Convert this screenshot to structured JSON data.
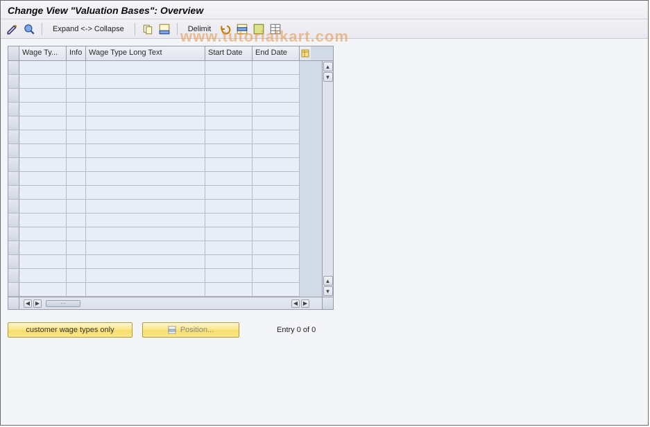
{
  "title": "Change View \"Valuation Bases\": Overview",
  "toolbar": {
    "expand_collapse_label": "Expand <-> Collapse",
    "delimit_label": "Delimit"
  },
  "table": {
    "columns": {
      "wage_type": "Wage Ty...",
      "info": "Info",
      "long_text": "Wage Type Long Text",
      "start_date": "Start Date",
      "end_date": "End Date"
    },
    "rows": [
      {},
      {},
      {},
      {},
      {},
      {},
      {},
      {},
      {},
      {},
      {},
      {},
      {},
      {},
      {},
      {},
      {}
    ]
  },
  "buttons": {
    "customer_only": "customer wage types only",
    "position": "Position..."
  },
  "status": {
    "entry_text": "Entry 0 of 0"
  },
  "watermark": "www.tutorialkart.com"
}
